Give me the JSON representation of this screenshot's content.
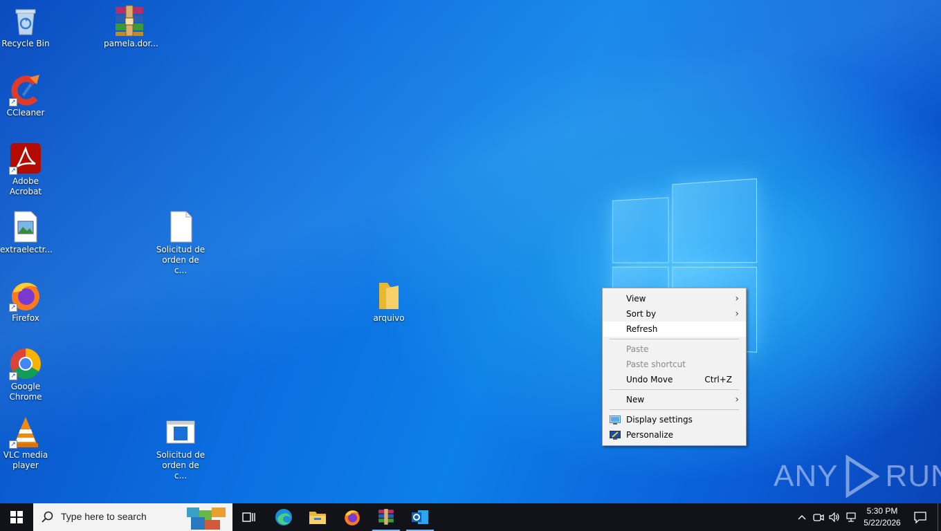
{
  "desktop": {
    "icons": [
      {
        "label": "Recycle Bin",
        "icon": "recycle-bin-icon"
      },
      {
        "label": "pamela.dor...",
        "icon": "winrar-archive-icon"
      },
      {
        "label": "CCleaner",
        "icon": "ccleaner-icon"
      },
      {
        "label": "Adobe Acrobat",
        "icon": "adobe-acrobat-icon"
      },
      {
        "label": "extraelectr...",
        "icon": "image-file-icon"
      },
      {
        "label": "Solicitud de orden de c...",
        "icon": "blank-file-icon"
      },
      {
        "label": "Firefox",
        "icon": "firefox-icon"
      },
      {
        "label": "arquivo",
        "icon": "folder-icon"
      },
      {
        "label": "Google Chrome",
        "icon": "chrome-icon"
      },
      {
        "label": "VLC media player",
        "icon": "vlc-icon"
      },
      {
        "label": "Solicitud de orden de c...",
        "icon": "document-window-icon"
      }
    ]
  },
  "context_menu": {
    "items": [
      {
        "label": "View",
        "state": "normal",
        "submenu": true
      },
      {
        "label": "Sort by",
        "state": "normal",
        "submenu": true
      },
      {
        "label": "Refresh",
        "state": "highlighted"
      },
      {
        "label": "Paste",
        "state": "disabled"
      },
      {
        "label": "Paste shortcut",
        "state": "disabled"
      },
      {
        "label": "Undo Move",
        "state": "normal",
        "shortcut": "Ctrl+Z"
      },
      {
        "label": "New",
        "state": "normal",
        "submenu": true
      },
      {
        "label": "Display settings",
        "state": "normal",
        "icon": "display-settings-icon"
      },
      {
        "label": "Personalize",
        "state": "normal",
        "icon": "personalize-icon"
      }
    ]
  },
  "watermark": {
    "left": "ANY",
    "right": "RUN"
  },
  "taskbar": {
    "search_placeholder": "Type here to search",
    "apps": [
      "task-view-icon",
      "edge-icon",
      "file-explorer-icon",
      "firefox-icon",
      "winrar-icon",
      "outlook-icon"
    ],
    "clock": {
      "time": "5:30 PM",
      "date": "5/22/2026"
    }
  },
  "colors": {
    "taskbar": "#111318",
    "menu_bg": "#f2f2f2",
    "highlight": "#ffffff",
    "accent": "#0078d7"
  }
}
